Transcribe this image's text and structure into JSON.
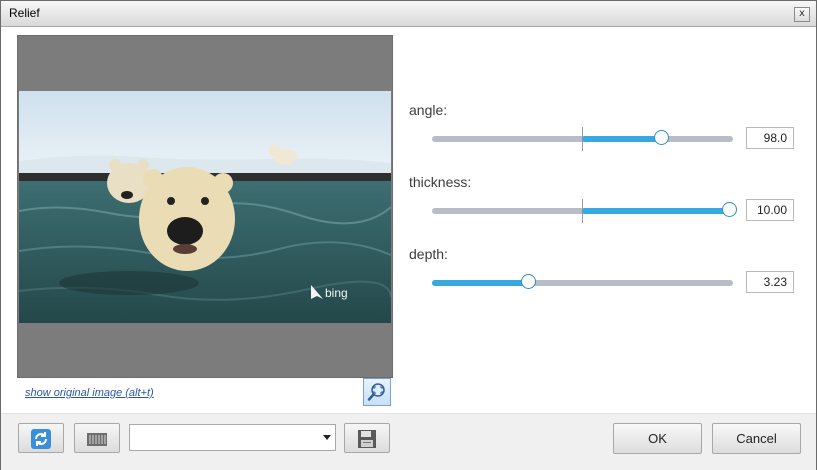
{
  "window": {
    "title": "Relief",
    "close_glyph": "x"
  },
  "preview": {
    "watermark": "bing",
    "show_original_label": "show original image (alt+t)",
    "zoom_icon": "magnifier-fit-icon"
  },
  "params": [
    {
      "label": "angle:",
      "value": "98.0",
      "position": 0.76,
      "fill_from": 0.5
    },
    {
      "label": "thickness:",
      "value": "10.00",
      "position": 1.0,
      "fill_from": 0.5
    },
    {
      "label": "depth:",
      "value": "3.23",
      "position": 0.323,
      "fill_from": 0.0
    }
  ],
  "footer": {
    "reset_icon": "refresh-icon",
    "presets_icon": "presets-grid-icon",
    "preset_value": "",
    "save_icon": "save-disk-icon",
    "ok_label": "OK",
    "cancel_label": "Cancel"
  },
  "colors": {
    "accent": "#36a9e1",
    "track": "#b8bcc4",
    "canvas_bg": "#7c7c7c"
  }
}
